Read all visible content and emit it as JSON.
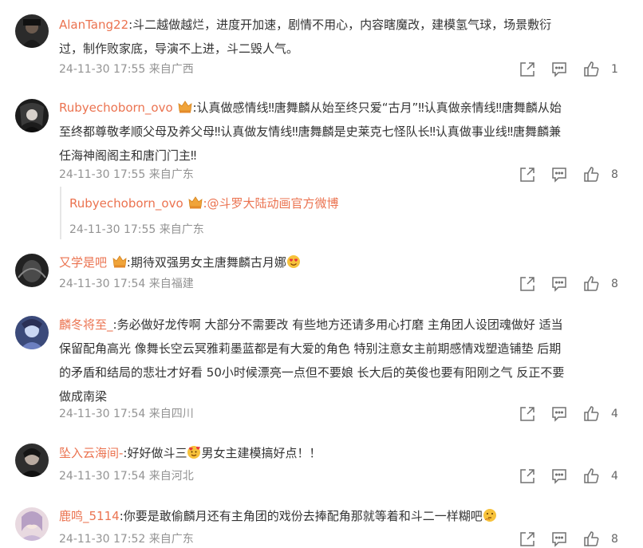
{
  "colors": {
    "username": "#eb7350",
    "text": "#333333",
    "meta": "#939393"
  },
  "comments": [
    {
      "username": "AlanTang22",
      "text": ":斗二越做越烂，进度开加速，剧情不用心，内容瞎魔改，建模氢气球，场景敷衍过，制作败家底，导演不上进，斗二毁人气。",
      "line1": ":斗二越做越烂，进度开加速，剧情不用心，内容瞎魔改，建模氢气球，场景敷衍",
      "line2": "过，制作败家底，导演不上进，斗二毁人气。",
      "time": "24-11-30 17:55 来自广西",
      "likes": "1"
    },
    {
      "username": "Rubyechoborn_ovo",
      "line1": ":认真做感情线‼唐舞麟从始至终只爱“古月”‼认真做亲情线‼唐舞麟从始",
      "line2": "至终都尊敬孝顺父母及养父母‼认真做友情线‼唐舞麟是史莱克七怪队长‼认真做事业线‼唐舞麟兼",
      "line3": "任海神阁阁主和唐门门主‼",
      "time": "24-11-30 17:55 来自广东",
      "likes": "8",
      "reply": {
        "username": "Rubyechoborn_ovo",
        "mention": ":@斗罗大陆动画官方微博",
        "time": "24-11-30 17:55 来自广东"
      }
    },
    {
      "username": "又学是吧",
      "text": ":期待双强男女主唐舞麟古月娜",
      "time": "24-11-30 17:54 来自福建",
      "likes": "8"
    },
    {
      "username": "麟冬将至_",
      "line1": ":务必做好龙传啊 大部分不需要改 有些地方还请多用心打磨 主角团人设团魂做好 适当",
      "line2": "保留配角高光 像舞长空云冥雅莉墨蓝都是有大爱的角色 特别注意女主前期感情戏塑造铺垫 后期",
      "line3": "的矛盾和结局的悲壮才好看 50小时候漂亮一点但不要娘 长大后的英俊也要有阳刚之气 反正不要",
      "line4": "做成南梁",
      "time": "24-11-30 17:54 来自四川",
      "likes": "4"
    },
    {
      "username": "坠入云海间-",
      "text_a": ":好好做斗三",
      "text_b": "男女主建模搞好点！！",
      "time": "24-11-30 17:54 来自河北",
      "likes": "4"
    },
    {
      "username": "鹿鸣_5114",
      "text": ":你要是敢偷麟月还有主角团的戏份去捧配角那就等着和斗二一样糊吧",
      "time": "24-11-30 17:52 来自广东",
      "likes": "8"
    }
  ],
  "icons": [
    "share-icon",
    "comment-icon",
    "like-icon",
    "crown-badge-icon"
  ]
}
